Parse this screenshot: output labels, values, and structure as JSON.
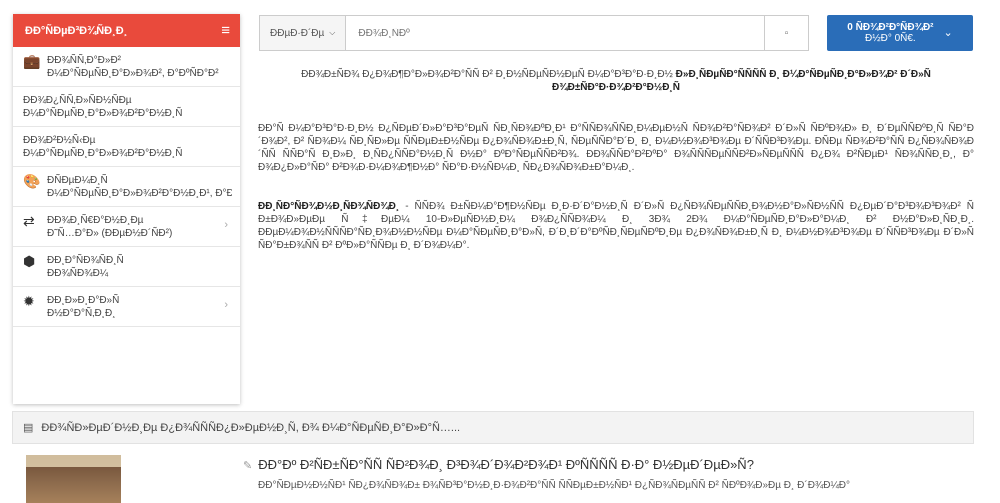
{
  "sidebar": {
    "title": "ÐÐ°ÑÐµÐ³Ð¾ÑÐ¸Ð¸",
    "menu_icon": "hamburger-icon",
    "items": [
      {
        "icon": "briefcase-icon",
        "glyph": "💼",
        "label_line1": "ÐÐ¾ÑÑ‚Ð°Ð»Ð²",
        "label_line2": "Ð¼Ð°ÑÐµÑÐ¸Ð°Ð»Ð¾Ð², Ð°ÐºÑÐ°Ð²",
        "chevron": false
      },
      {
        "icon": "",
        "glyph": "",
        "label_line1": "ÐÐ¾Ð¿ÑÑ‚Ð»ÑÐ½ÑÐµ",
        "label_line2": "Ð¼Ð°ÑÐµÑÐ¸Ð°Ð»Ð¾Ð²Ð°Ð½Ð¸Ñ",
        "chevron": false
      },
      {
        "icon": "",
        "glyph": "",
        "label_line1": "ÐÐ¾Ð²Ð½Ñ‹Ðµ",
        "label_line2": "Ð¼Ð°ÑÐµÑÐ¸Ð°Ð»Ð¾Ð²Ð°Ð½Ð¸Ñ",
        "chevron": false
      },
      {
        "icon": "palette-icon",
        "glyph": "🎨",
        "label_line1": "ÐÑÐµÐ¼Ð¸Ñ",
        "label_line2": "Ð¼Ð°ÑÐµÑÐ¸Ð°Ð»Ð¾Ð²Ð°Ð½Ð¸Ð¹, Ð°ÐºÑÐ°Ð²",
        "chevron": false
      },
      {
        "icon": "exchange-icon",
        "glyph": "⇄",
        "label_line1": "ÐÐ¾Ð¸Ñ€Ð°Ð½Ð¸Ðµ",
        "label_line2": "Ð˜Ñ…Ð°Ð» (ÐÐµÐ½Ð´ÑÐ²)",
        "chevron": true
      },
      {
        "icon": "cube-icon",
        "glyph": "⬢",
        "label_line1": "ÐÐ¸Ð°ÑÐ¾ÑÐ¸Ñ",
        "label_line2": "ÐÐ¾ÑÐ¾Ð¼",
        "chevron": false
      },
      {
        "icon": "bug-icon",
        "glyph": "✹",
        "label_line1": "ÐÐ¸Ð»Ð¸Ð°Ð»Ñ",
        "label_line2": "Ð½Ð°Ð°Ñ‚Ð¸Ð¸",
        "chevron": true
      }
    ]
  },
  "search": {
    "category": "ÐÐµÐ·Ð´Ðµ",
    "placeholder": "ÐÐ¾Ð¸ÑÐº",
    "button_icon": "search-icon"
  },
  "cart": {
    "line1": "0 ÑÐ¾Ð²Ð°ÑÐ¾Ð²",
    "line2": "Ð½Ð° 0Ñ€.",
    "chevron_icon": "chevron-down-icon"
  },
  "main": {
    "intro": "ÐÐ¾Ð±ÑÐ¾ Ð¿Ð¾Ð¶Ð°Ð»Ð¾Ð²Ð°ÑÑ Ð² Ð¸Ð½ÑÐµÑÐ½ÐµÑ Ð¼Ð°Ð³Ð°Ð·Ð¸Ð½",
    "intro_bold": "Ð»Ð¸ÑÐµÑÐ°ÑÑÑÑ Ð¸ Ð¼Ð°ÑÐµÑÐ¸Ð°Ð»Ð¾Ð² Ð´Ð»Ñ Ð¾Ð±ÑÐ°Ð·Ð¾Ð²Ð°Ð½Ð¸Ñ",
    "para2": "ÐÐ°Ñ Ð¼Ð°Ð³Ð°Ð·Ð¸Ð½ Ð¿ÑÐµÐ´Ð»Ð°Ð³Ð°ÐµÑ ÑÐ¸ÑÐ¾ÐºÐ¸Ð¹ Ð°ÑÑÐ¾ÑÑÐ¸Ð¼ÐµÐ½Ñ ÑÐ¾Ð²Ð°ÑÐ¾Ð² Ð´Ð»Ñ ÑÐºÐ¾Ð» Ð¸ Ð´ÐµÑÑÐºÐ¸Ñ ÑÐ°Ð´Ð¾Ð², Ð² ÑÐ¾Ð¼ ÑÐ¸ÑÐ»Ðµ ÑÑÐµÐ±Ð½ÑÐµ Ð¿Ð¾ÑÐ¾Ð±Ð¸Ñ, ÑÐµÑÑÐ°Ð´Ð¸ Ð¸ Ð¼Ð½Ð¾Ð³Ð¾Ðµ Ð´ÑÑÐ³Ð¾Ðµ. ÐÑÐµ ÑÐ¾Ð²Ð°ÑÑ Ð¿ÑÐ¾ÑÐ¾Ð´ÑÑ ÑÑÐ°Ñ Ð¸Ð»Ð¸ Ð¸ÑÐ¿ÑÑÐ°Ð½Ð¸Ñ Ð½Ð° ÐºÐ°ÑÐµÑÑÐ²Ð¾. ÐÐ¾ÑÑÐ°Ð²ÐºÐ° Ð¾ÑÑÑÐµÑÑÐ²Ð»ÑÐµÑÑÑ Ð¿Ð¾ Ð²ÑÐµÐ¹ ÑÐ¾ÑÑÐ¸Ð¸, Ð° Ð¾Ð¿Ð»Ð°ÑÐ° Ð²Ð¾Ð·Ð¼Ð¾Ð¶Ð½Ð° ÑÐ°Ð·Ð½ÑÐ¼Ð¸ ÑÐ¿Ð¾ÑÐ¾Ð±Ð°Ð¼Ð¸.",
    "para3_bold": "ÐÐ¸ÑÐ°ÑÐ¾Ð½Ð¸ÑÐ¾ÑÐ¾Ð¸",
    "para3": " - ÑÑÐ¾ Ð±ÑÐ¼Ð°Ð¶Ð½ÑÐµ Ð¸Ð·Ð´Ð°Ð½Ð¸Ñ Ð´Ð»Ñ Ð¿ÑÐ¾ÑÐµÑÑÐ¸Ð¾Ð½Ð°Ð»ÑÐ½ÑÑ Ð¿ÐµÐ´Ð°Ð³Ð¾Ð³Ð¾Ð² Ñ Ð±Ð¾Ð»ÐµÐµ Ñ‡ÐµÐ¼ 10-Ð»ÐµÑÐ½Ð¸Ð¼ Ð¾Ð¿ÑÑÐ¾Ð¼ Ð¸ 3Ð¾ 2Ð¾ Ð¼Ð°ÑÐµÑÐ¸Ð°Ð»Ð°Ð¼Ð¸ Ð² Ð½Ð°Ð»Ð¸ÑÐ¸Ð¸. ÐÐµÐ¼Ð¾Ð½ÑÑÑÐ°ÑÐ¸Ð¾Ð½Ð½ÑÐµ Ð¼Ð°ÑÐµÑÐ¸Ð°Ð»Ñ, Ð´Ð¸Ð´Ð°ÐºÑÐ¸ÑÐµÑÐºÐ¸Ðµ Ð¿Ð¾ÑÐ¾Ð±Ð¸Ñ Ð¸ Ð¼Ð½Ð¾Ð³Ð¾Ðµ Ð´ÑÑÐ³Ð¾Ðµ Ð´Ð»Ñ ÑÐ°Ð±Ð¾ÑÑ Ð² ÐºÐ»Ð°ÑÑÐµ Ð¸ Ð´Ð¾Ð¼Ð°."
  },
  "section": {
    "icon": "newspaper-icon",
    "title": "ÐÐ¾ÑÐ»ÐµÐ´Ð½Ð¸Ðµ Ð¿Ð¾ÑÑÑÐ¿Ð»ÐµÐ½Ð¸Ñ, Ð¾ Ð¼Ð°ÑÐµÑÐ¸Ð°Ð»Ð°Ñ…..."
  },
  "article": {
    "title": "ÐÐ°Ðº Ð²ÑÐ±ÑÐ°ÑÑ ÑÐ²Ð¾Ð¸ Ð³Ð¾Ð´Ð¾Ð²Ð¾Ð¹ ÐºÑÑÑÑ Ð·Ð° Ð½ÐµÐ´ÐµÐ»Ñ?",
    "text": "ÐÐ°ÑÐµÐ½Ð½ÑÐ¹ ÑÐ¿Ð¾ÑÐ¾Ð± Ð¾ÑÐ³Ð°Ð½Ð¸Ð·Ð¾Ð²Ð°ÑÑ ÑÑÐµÐ±Ð½ÑÐ¹ Ð¿ÑÐ¾ÑÐµÑÑ Ð² ÑÐºÐ¾Ð»Ðµ Ð¸ Ð´Ð¾Ð¼Ð°",
    "thumb": "classroom-photo"
  }
}
